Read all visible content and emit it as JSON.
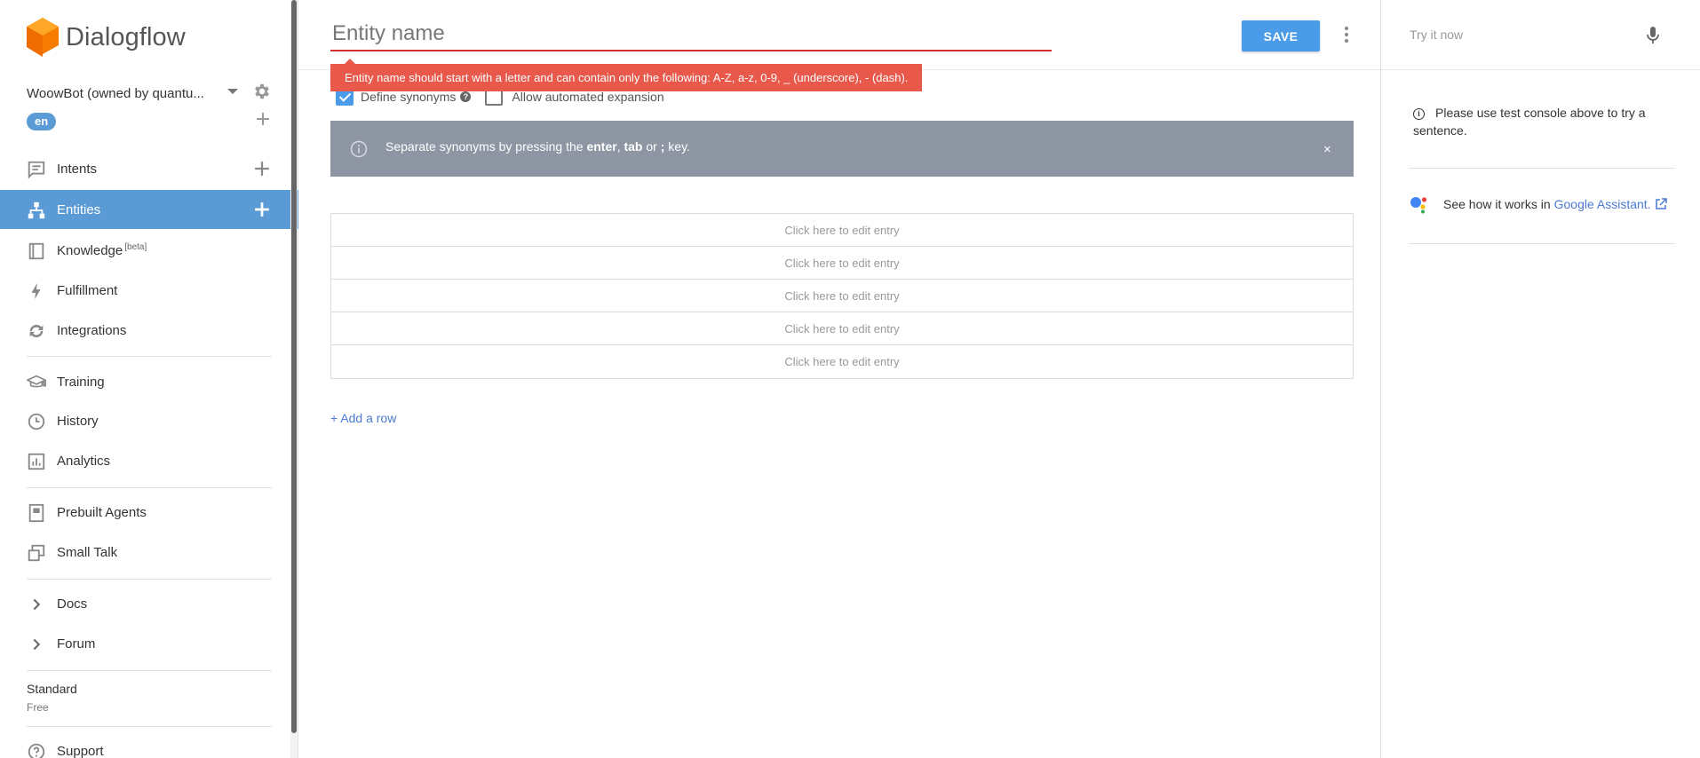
{
  "app": {
    "brand": "Dialogflow"
  },
  "sidebar": {
    "agent_name": "WoowBot (owned by quantu...",
    "language": "en",
    "nav": [
      {
        "id": "intents",
        "label": "Intents",
        "icon": "chat-icon",
        "has_add": true
      },
      {
        "id": "entities",
        "label": "Entities",
        "icon": "hierarchy-icon",
        "has_add": true,
        "active": true
      },
      {
        "id": "knowledge",
        "label": "Knowledge",
        "badge": "[beta]",
        "icon": "book-icon"
      },
      {
        "id": "fulfillment",
        "label": "Fulfillment",
        "icon": "bolt-icon"
      },
      {
        "id": "integrations",
        "label": "Integrations",
        "icon": "sync-icon"
      },
      {
        "id": "training",
        "label": "Training",
        "icon": "graduation-cap-icon"
      },
      {
        "id": "history",
        "label": "History",
        "icon": "clock-icon"
      },
      {
        "id": "analytics",
        "label": "Analytics",
        "icon": "bar-chart-icon"
      },
      {
        "id": "prebuilt-agents",
        "label": "Prebuilt Agents",
        "icon": "agent-book-icon"
      },
      {
        "id": "small-talk",
        "label": "Small Talk",
        "icon": "chat-squares-icon"
      },
      {
        "id": "docs",
        "label": "Docs",
        "icon": "chevron-right-icon"
      },
      {
        "id": "forum",
        "label": "Forum",
        "icon": "chevron-right-icon"
      },
      {
        "id": "support",
        "label": "Support",
        "icon": "help-circle-icon"
      }
    ],
    "plan": {
      "name": "Standard",
      "tier": "Free"
    }
  },
  "editor": {
    "entity_name_placeholder": "Entity name",
    "save_label": "SAVE",
    "error_message": "Entity name should start with a letter and can contain only the following: A-Z, a-z, 0-9, _ (underscore), - (dash).",
    "define_synonyms_label": "Define synonyms",
    "define_synonyms_checked": true,
    "allow_expansion_label": "Allow automated expansion",
    "allow_expansion_checked": false,
    "info": {
      "prefix": "Separate synonyms by pressing the ",
      "key1": "enter",
      "sep1": ", ",
      "key2": "tab",
      "sep2": " or ",
      "key3": ";",
      "suffix": " key.",
      "close": "×"
    },
    "entries": [
      "Click here to edit entry",
      "Click here to edit entry",
      "Click here to edit entry",
      "Click here to edit entry",
      "Click here to edit entry"
    ],
    "add_row_label": "+ Add a row"
  },
  "right_panel": {
    "try_label": "Try it now",
    "note": "Please use test console above to try a sentence.",
    "ga_text": "See how it works in",
    "ga_link": "Google Assistant."
  },
  "colors": {
    "accent": "#5b9bd5",
    "save": "#4a9be8",
    "error": "#e8594c",
    "banner": "#8e96a3",
    "link": "#4a7bd0",
    "brand_orange": "#f57c00"
  }
}
